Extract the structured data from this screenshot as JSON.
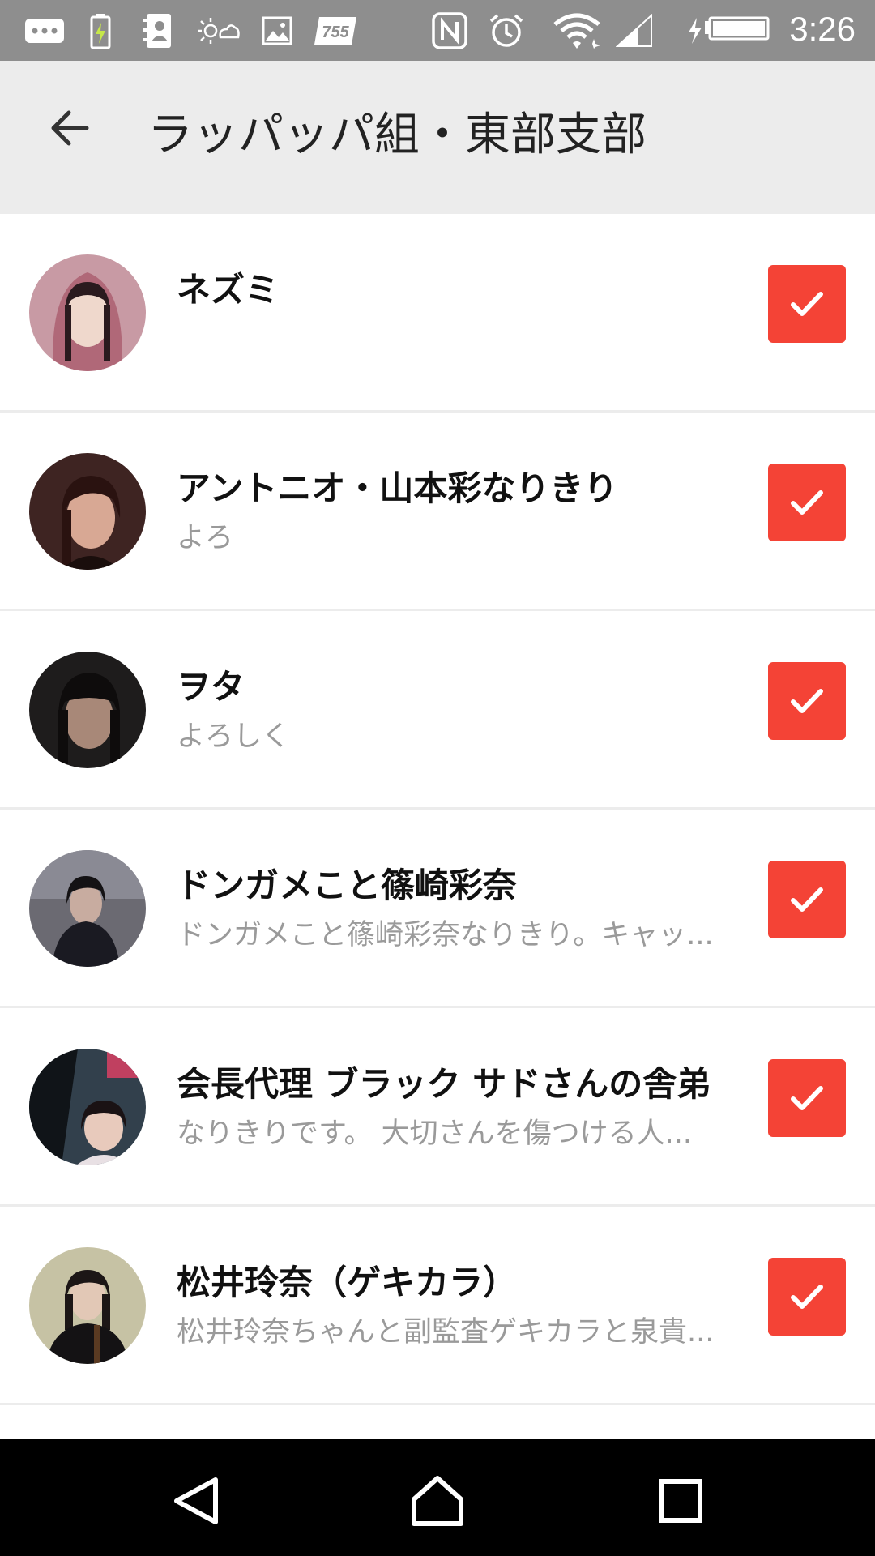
{
  "status_bar": {
    "time": "3:26",
    "notification_badge": "755",
    "icons": [
      "chat-icon",
      "battery-charging-icon",
      "contacts-icon",
      "weather-icon",
      "image-icon",
      "app-badge-icon",
      "nfc-icon",
      "alarm-icon",
      "wifi-icon",
      "signal-icon",
      "battery-icon"
    ]
  },
  "header": {
    "title": "ラッパッパ組・東部支部",
    "back_icon": "arrow-back-icon"
  },
  "members": [
    {
      "name": "ネズミ",
      "description": "",
      "checked": true,
      "avatar_color": "#b07080"
    },
    {
      "name": "アントニオ・山本彩なりきり",
      "description": "よろ",
      "checked": true,
      "avatar_color": "#4a2a28"
    },
    {
      "name": "ヲタ",
      "description": "よろしく",
      "checked": true,
      "avatar_color": "#2a2626"
    },
    {
      "name": "ドンガメこと篠崎彩奈",
      "description": "ドンガメこと篠崎彩奈なりきり。キャッ...",
      "checked": true,
      "avatar_color": "#5b5a60"
    },
    {
      "name": "会長代理 ブラック サドさんの舎弟",
      "description": "なりきりです。 大切さんを傷つける人...",
      "checked": true,
      "avatar_color": "#2e3a44"
    },
    {
      "name": "松井玲奈（ゲキカラ）",
      "description": "松井玲奈ちゃんと副監査ゲキカラと泉貴...",
      "checked": true,
      "avatar_color": "#3a3a2e"
    }
  ],
  "colors": {
    "accent": "#f44336",
    "status_bar": "#8e8e8e",
    "app_bar": "#ececec",
    "nav_bar": "#000000"
  },
  "nav_bar": {
    "icons": [
      "back-nav-icon",
      "home-nav-icon",
      "recents-nav-icon"
    ]
  }
}
